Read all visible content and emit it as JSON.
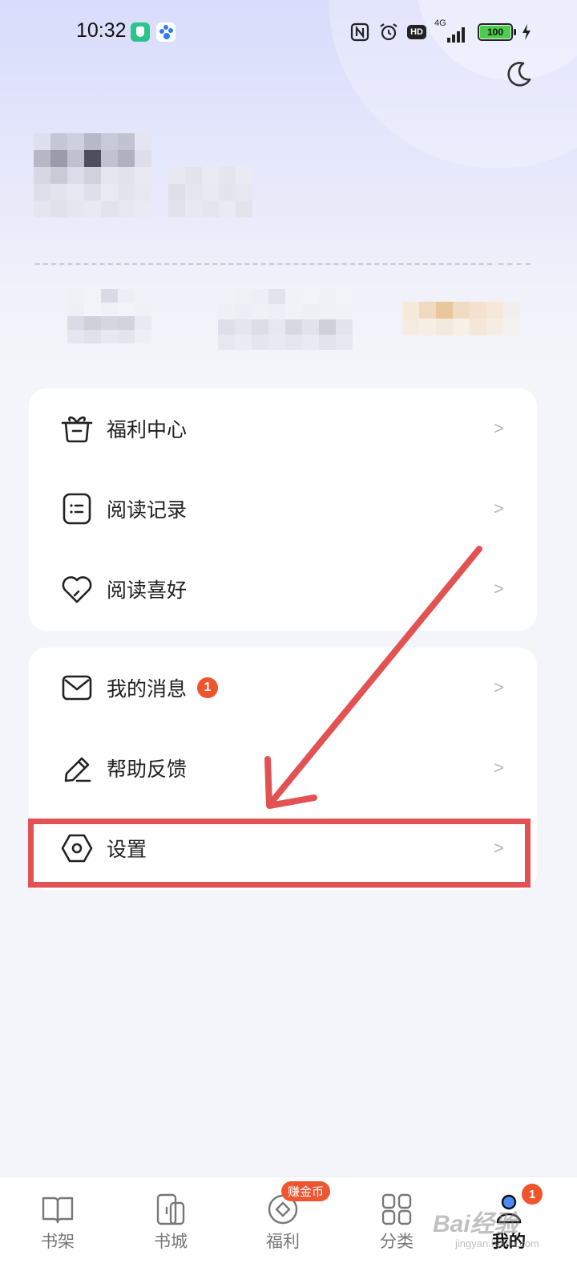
{
  "status_bar": {
    "time": "10:32",
    "hd_label": "HD",
    "network_label": "4G",
    "battery_level": "100"
  },
  "menu_group_1": [
    {
      "label": "福利中心",
      "chevron": ">",
      "icon": "gift-box-icon"
    },
    {
      "label": "阅读记录",
      "chevron": ">",
      "icon": "reading-record-icon"
    },
    {
      "label": "阅读喜好",
      "chevron": ">",
      "icon": "heart-icon"
    }
  ],
  "menu_group_2": [
    {
      "label": "我的消息",
      "chevron": ">",
      "icon": "mail-icon",
      "badge": "1"
    },
    {
      "label": "帮助反馈",
      "chevron": ">",
      "icon": "pencil-icon"
    },
    {
      "label": "设置",
      "chevron": ">",
      "icon": "settings-icon"
    }
  ],
  "bottom_nav": {
    "items": [
      {
        "label": "书架",
        "icon": "bookshelf-icon"
      },
      {
        "label": "书城",
        "icon": "bookstore-icon"
      },
      {
        "label": "福利",
        "icon": "coin-icon",
        "tag": "赚金币"
      },
      {
        "label": "分类",
        "icon": "category-grid-icon"
      },
      {
        "label": "我的",
        "icon": "profile-icon",
        "badge": "1",
        "active": true
      }
    ]
  },
  "watermark": {
    "main": "Bai经验",
    "sub": "jingyan.baidu.com"
  },
  "colors": {
    "accent_red": "#f0542c",
    "annotation_red": "#e35252",
    "header_gradient_top": "#d9dcfb",
    "page_bg": "#f4f5fa"
  }
}
